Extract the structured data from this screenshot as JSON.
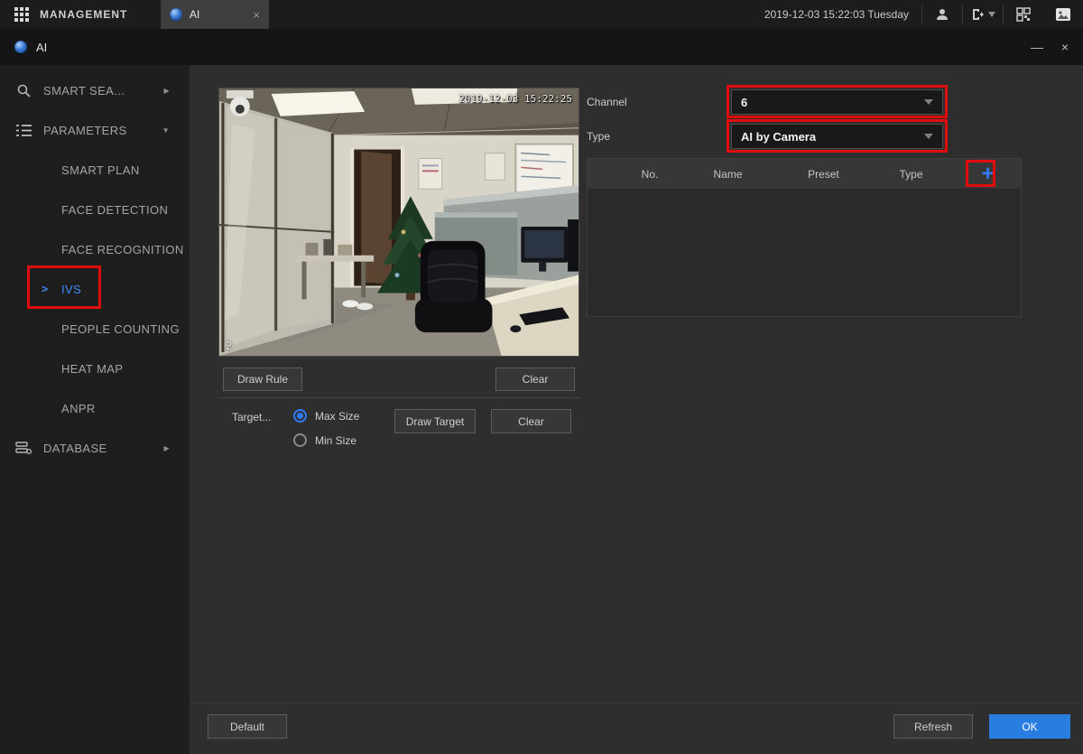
{
  "topbar": {
    "management_label": "MANAGEMENT",
    "tab_label": "AI",
    "tab_close": "×",
    "datetime": "2019-12-03 15:22:03 Tuesday"
  },
  "window": {
    "title": "AI",
    "minimize": "—",
    "close": "×"
  },
  "sidebar": {
    "items": [
      {
        "label": "SMART SEA...",
        "arrow": "▶"
      },
      {
        "label": "PARAMETERS",
        "arrow": "▼"
      },
      {
        "label": "SMART PLAN"
      },
      {
        "label": "FACE DETECTION"
      },
      {
        "label": "FACE RECOGNITION"
      },
      {
        "label": "IVS",
        "selected_chevron": ">"
      },
      {
        "label": "PEOPLE COUNTING"
      },
      {
        "label": "HEAT MAP"
      },
      {
        "label": "ANPR"
      },
      {
        "label": "DATABASE",
        "arrow": "▶"
      }
    ]
  },
  "main": {
    "channel_label": "Channel",
    "channel_value": "6",
    "type_label": "Type",
    "type_value": "AI by Camera",
    "table": {
      "headers": [
        "No.",
        "Name",
        "Preset",
        "Type"
      ],
      "add_label": "+",
      "rows": []
    },
    "video": {
      "timestamp": "2019-12-03 15:22:25",
      "channel_badge": "2"
    },
    "draw_rule_label": "Draw Rule",
    "clear_rule_label": "Clear",
    "target_label": "Target...",
    "max_size_label": "Max Size",
    "min_size_label": "Min Size",
    "draw_target_label": "Draw Target",
    "clear_target_label": "Clear",
    "footer": {
      "default_label": "Default",
      "refresh_label": "Refresh",
      "ok_label": "OK"
    }
  },
  "colors": {
    "accent_blue": "#2f7bf5",
    "selected_text": "#3f8cff",
    "annotation_red": "#e10c0c",
    "ok_button": "#2a7de0"
  }
}
